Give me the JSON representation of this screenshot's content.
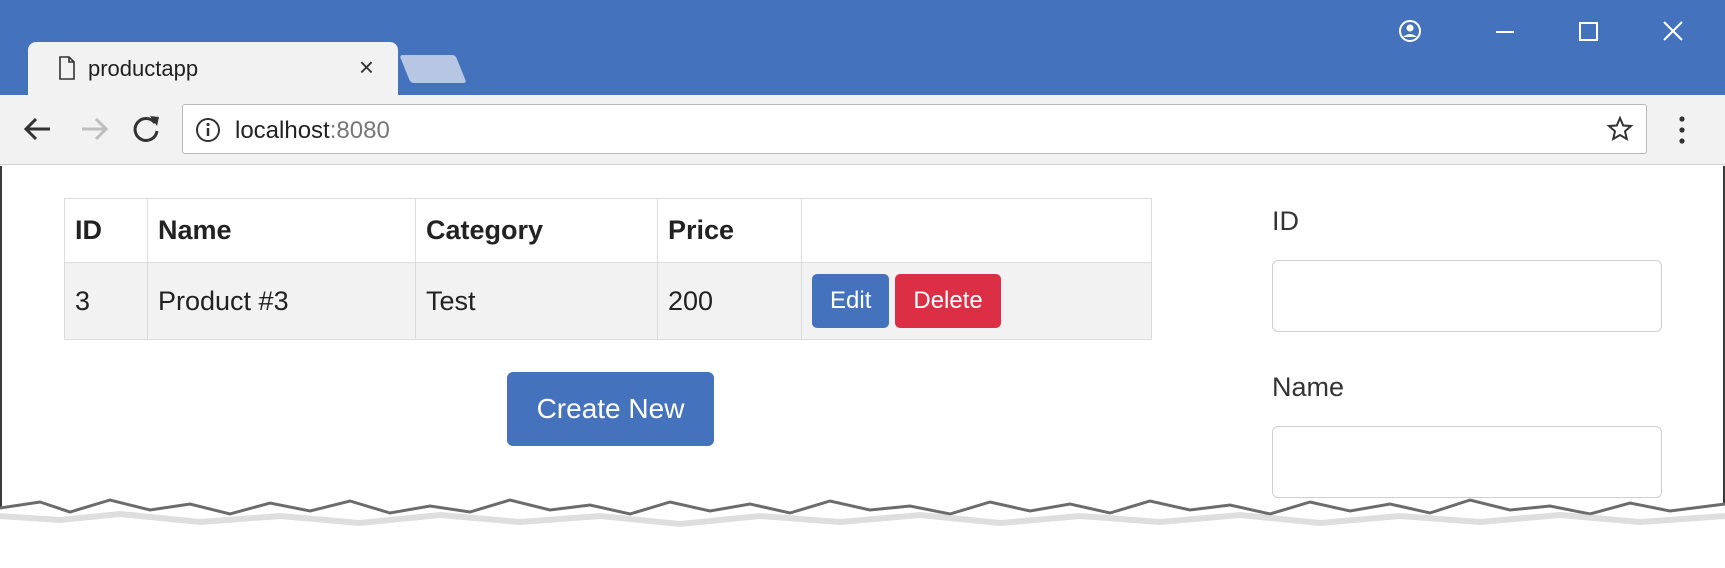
{
  "browser": {
    "tab_title": "productapp",
    "tab_close": "×",
    "url_host": "localhost",
    "url_port": ":8080",
    "icons": [
      "document-icon",
      "account-icon",
      "minimize-icon",
      "maximize-icon",
      "close-icon",
      "back-icon",
      "forward-icon",
      "reload-icon",
      "info-icon",
      "star-icon",
      "menu-icon"
    ]
  },
  "table": {
    "headers": [
      "ID",
      "Name",
      "Category",
      "Price",
      ""
    ],
    "rows": [
      {
        "id": "3",
        "name": "Product #3",
        "category": "Test",
        "price": "200"
      }
    ],
    "edit_label": "Edit",
    "delete_label": "Delete"
  },
  "create_label": "Create New",
  "form": {
    "id_label": "ID",
    "id_value": "",
    "name_label": "Name",
    "name_value": ""
  },
  "colors": {
    "titlebar": "#4472bd",
    "primary": "#4472bd",
    "danger": "#dc2f45"
  }
}
